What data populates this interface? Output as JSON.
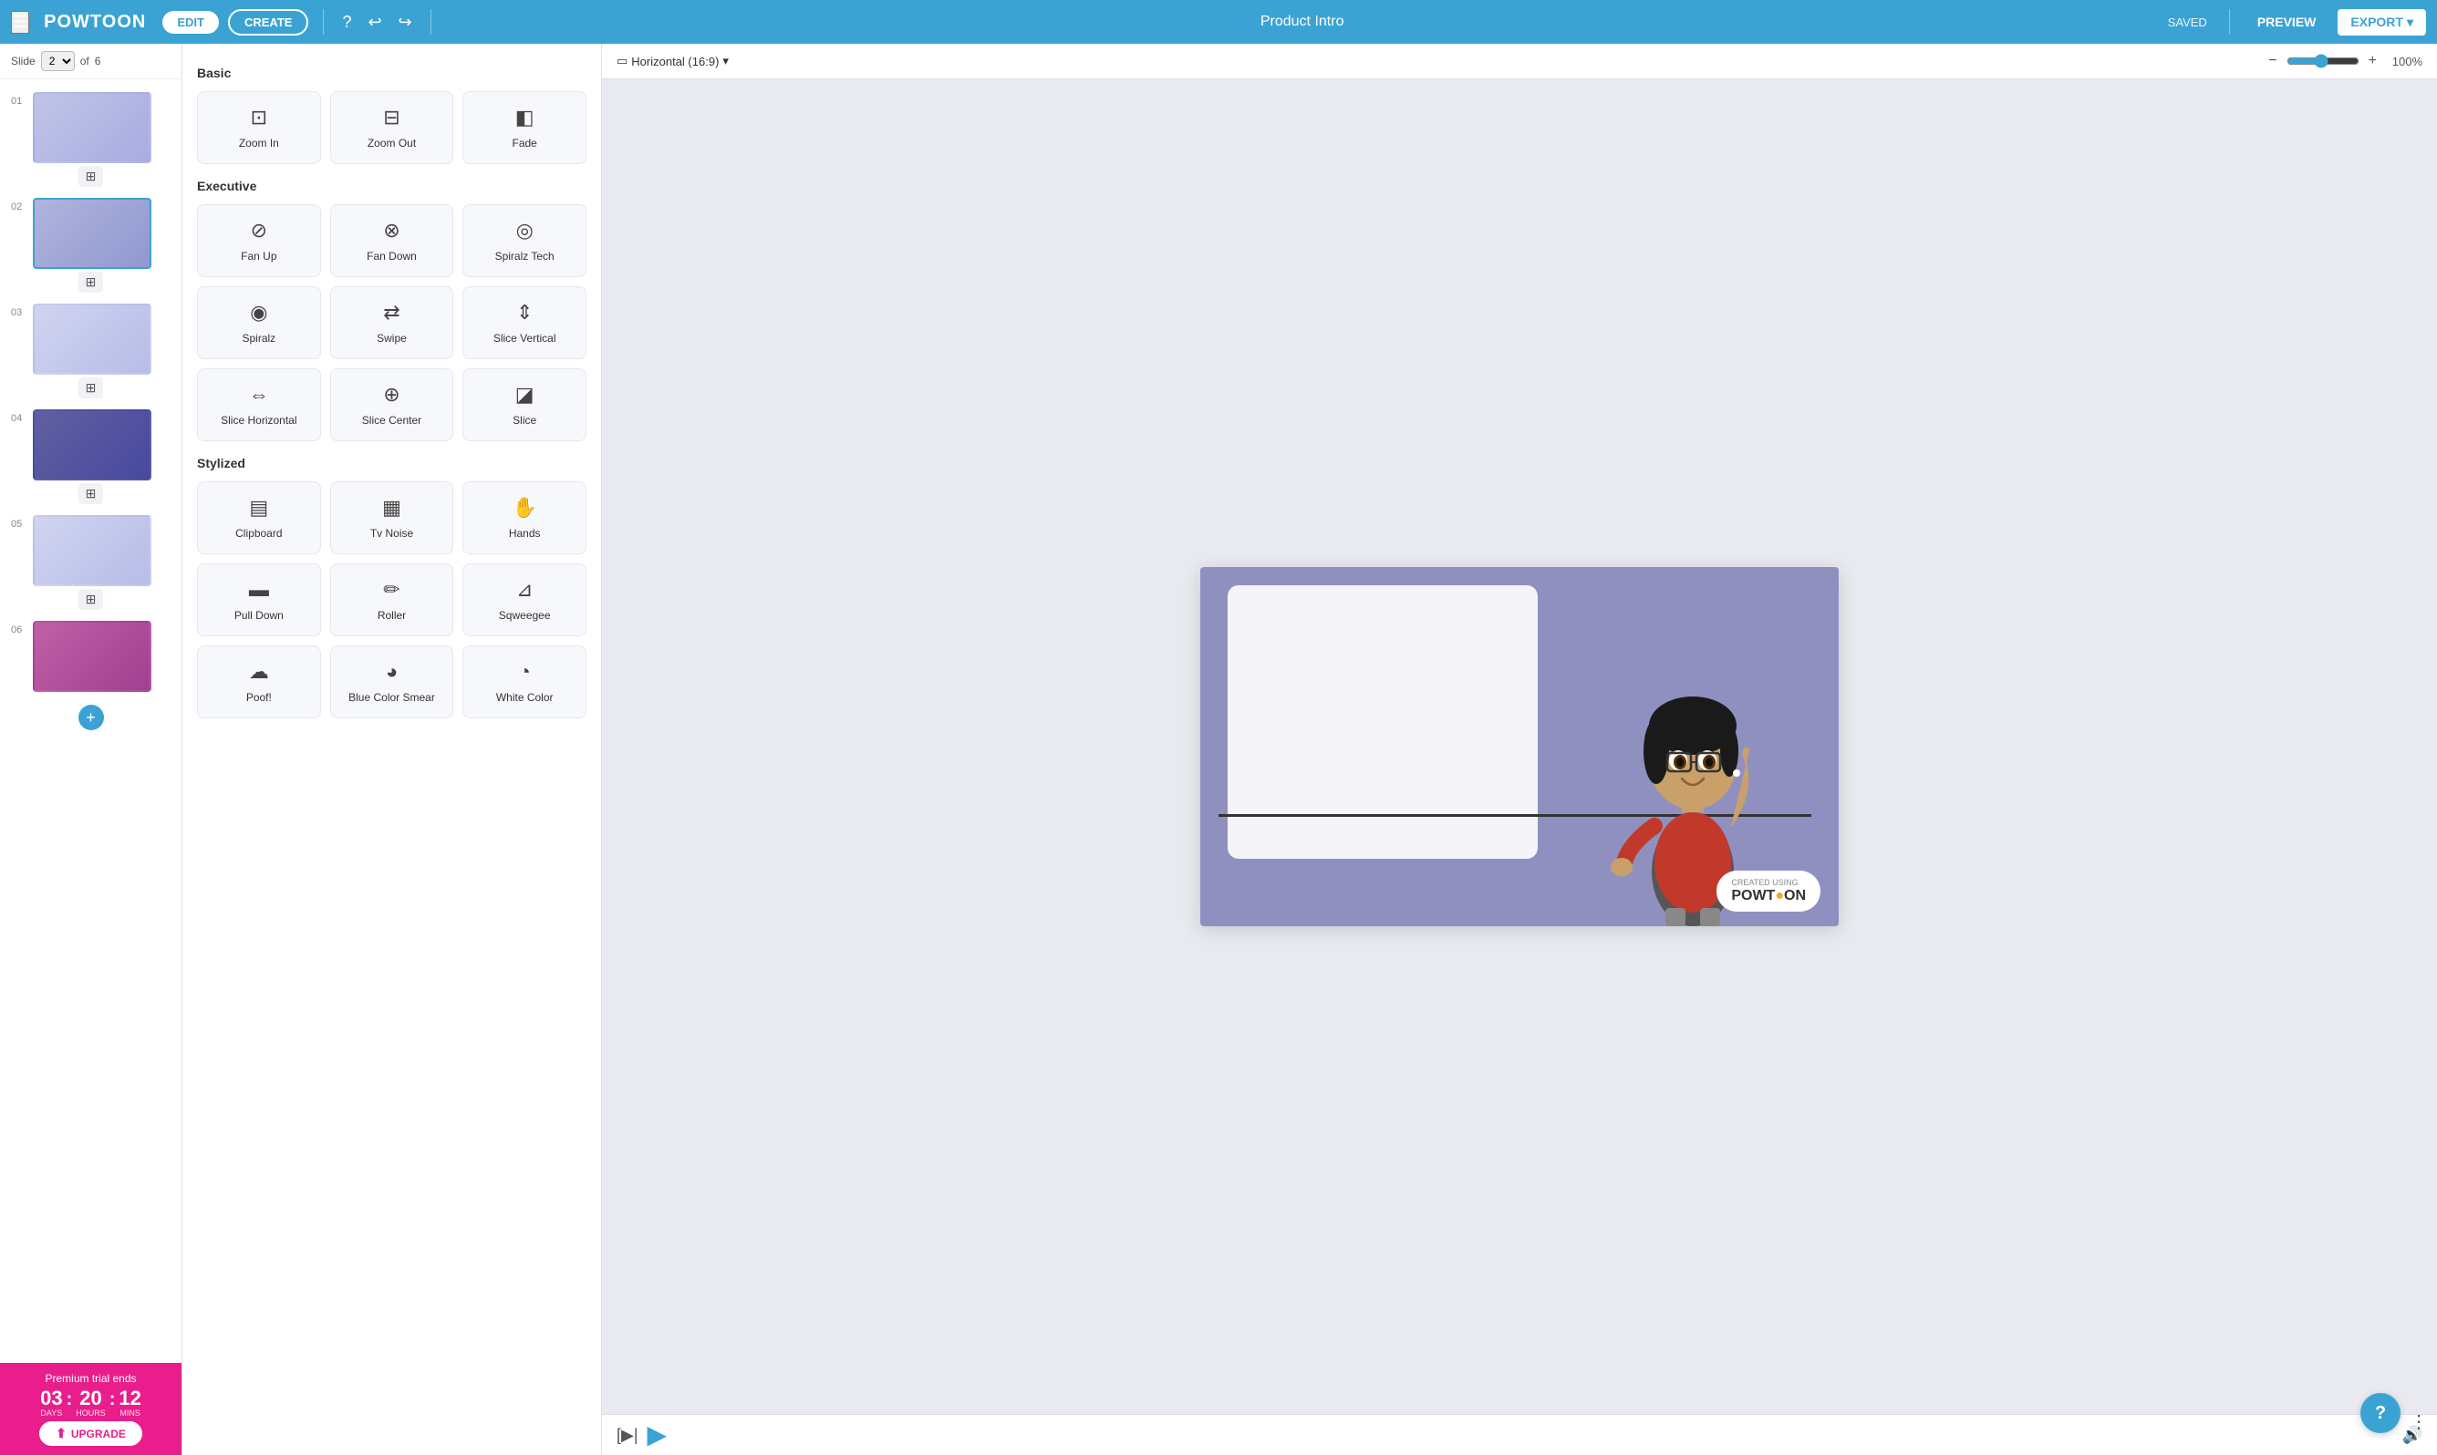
{
  "topbar": {
    "title": "Product Intro",
    "edit_label": "EDIT",
    "create_label": "CREATE",
    "saved_label": "SAVED",
    "preview_label": "PREVIEW",
    "export_label": "EXPORT",
    "logo": "POWTOON"
  },
  "slide_nav": {
    "slide_label": "Slide",
    "current_slide": "2",
    "total_slides": "6",
    "of_label": "of"
  },
  "slides": [
    {
      "id": "01",
      "label": "01"
    },
    {
      "id": "02",
      "label": "02"
    },
    {
      "id": "03",
      "label": "03"
    },
    {
      "id": "04",
      "label": "04"
    },
    {
      "id": "05",
      "label": "05"
    },
    {
      "id": "06",
      "label": "06"
    }
  ],
  "premium": {
    "title": "Premium trial ends",
    "days": "03",
    "hours": "20",
    "mins": "12",
    "days_label": "DAYS",
    "hours_label": "HOURS",
    "mins_label": "MINS",
    "upgrade_label": "UPGRADE"
  },
  "transitions": {
    "sections": [
      {
        "title": "Basic",
        "items": [
          {
            "label": "Zoom In",
            "icon": "⊡"
          },
          {
            "label": "Zoom Out",
            "icon": "⊟"
          },
          {
            "label": "Fade",
            "icon": "◧"
          }
        ]
      },
      {
        "title": "Executive",
        "items": [
          {
            "label": "Fan Up",
            "icon": "⊘"
          },
          {
            "label": "Fan Down",
            "icon": "⊗"
          },
          {
            "label": "Spiralz Tech",
            "icon": "◎"
          },
          {
            "label": "Spiralz",
            "icon": "◉"
          },
          {
            "label": "Swipe",
            "icon": "⇄"
          },
          {
            "label": "Slice Vertical",
            "icon": "⇕"
          },
          {
            "label": "Slice Horizontal",
            "icon": "⇔"
          },
          {
            "label": "Slice Center",
            "icon": "⊕"
          },
          {
            "label": "Slice",
            "icon": "◪"
          }
        ]
      },
      {
        "title": "Stylized",
        "items": [
          {
            "label": "Clipboard",
            "icon": "▤"
          },
          {
            "label": "Tv Noise",
            "icon": "▦"
          },
          {
            "label": "Hands",
            "icon": "✋"
          },
          {
            "label": "Pull Down",
            "icon": "▬"
          },
          {
            "label": "Roller",
            "icon": "✏"
          },
          {
            "label": "Sqweegee",
            "icon": "⊿"
          },
          {
            "label": "Poof!",
            "icon": "☁"
          },
          {
            "label": "Blue Color Smear",
            "icon": "◕"
          },
          {
            "label": "White Color",
            "icon": "◔"
          }
        ]
      }
    ]
  },
  "canvas": {
    "aspect_ratio": "Horizontal (16:9)",
    "zoom_level": "100%",
    "zoom_value": 100
  },
  "watermark": {
    "created_using": "CREATED USING",
    "logo": "POWTOON"
  }
}
